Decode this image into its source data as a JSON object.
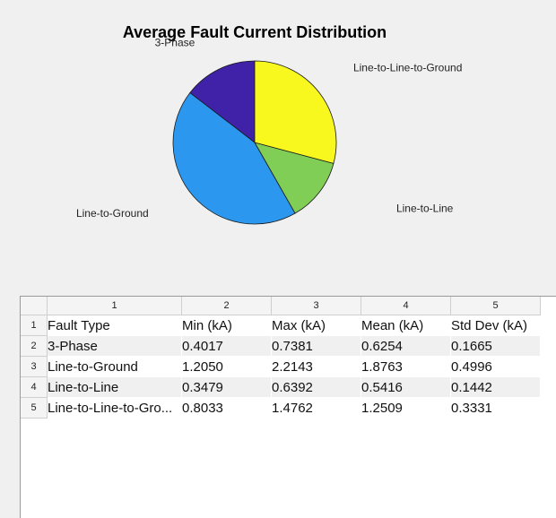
{
  "chart_data": {
    "type": "pie",
    "title": "Average Fault Current Distribution",
    "series": [
      {
        "values": [
          0.6254,
          1.8763,
          0.5416,
          1.2509
        ],
        "labels": [
          "3-Phase",
          "Line-to-Ground",
          "Line-to-Line",
          "Line-to-Line-to-Ground"
        ],
        "colors": [
          "#3f22a8",
          "#2c97ef",
          "#80ce56",
          "#f8f81e"
        ]
      }
    ],
    "start_angle_deg": 0,
    "direction": "counterclockwise",
    "legend": "none"
  },
  "table": {
    "column_numbers": [
      "1",
      "2",
      "3",
      "4",
      "5"
    ],
    "row_numbers": [
      "1",
      "2",
      "3",
      "4",
      "5"
    ],
    "rows": [
      [
        "Fault Type",
        "Min (kA)",
        "Max (kA)",
        "Mean (kA)",
        "Std Dev (kA)"
      ],
      [
        "3-Phase",
        "0.4017",
        "0.7381",
        "0.6254",
        "0.1665"
      ],
      [
        "Line-to-Ground",
        "1.2050",
        "2.2143",
        "1.8763",
        "0.4996"
      ],
      [
        "Line-to-Line",
        "0.3479",
        "0.6392",
        "0.5416",
        "0.1442"
      ],
      [
        "Line-to-Line-to-Gro...",
        "0.8033",
        "1.4762",
        "1.2509",
        "0.3331"
      ]
    ]
  }
}
